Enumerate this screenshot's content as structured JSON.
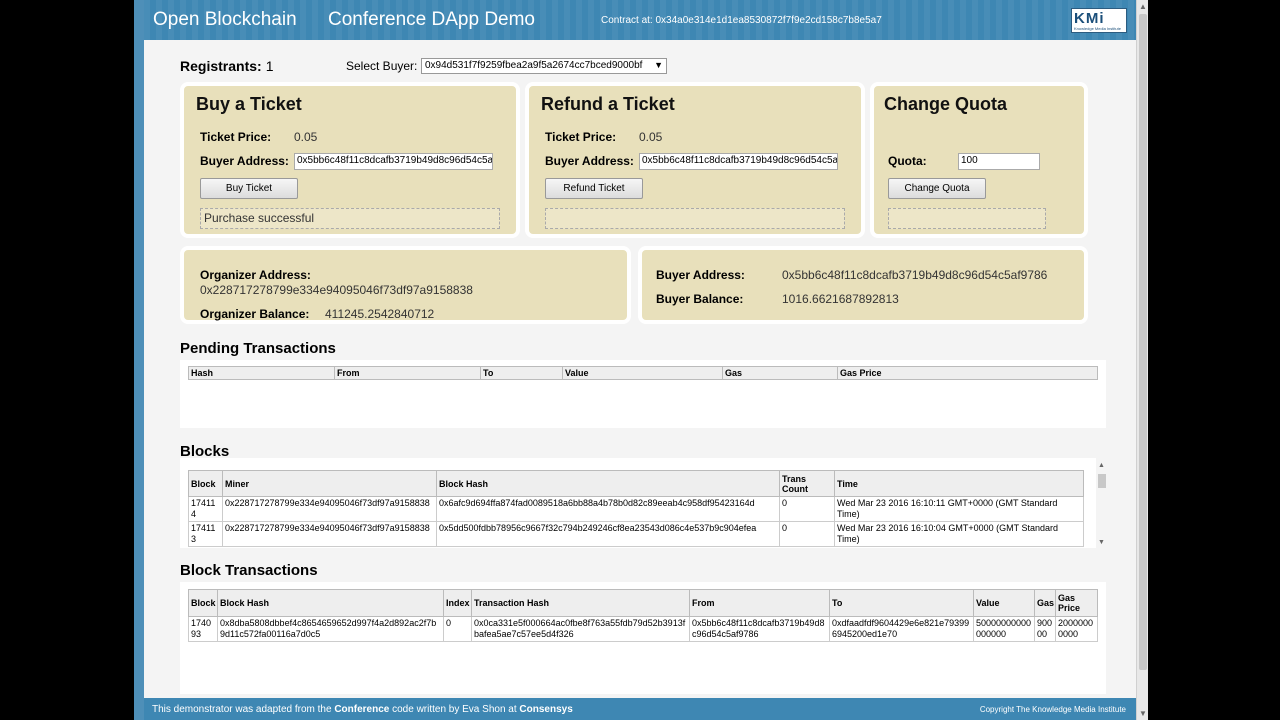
{
  "header": {
    "brand": "Open Blockchain",
    "title": "Conference DApp Demo",
    "contract": "Contract at: 0x34a0e314e1d1ea8530872f7f9e2cd158c7b8e5a7",
    "logo_letters": "KMi",
    "logo_small": "Knowledge Media Institute"
  },
  "registrants": {
    "label": "Registrants:",
    "value": "1"
  },
  "select_buyer": {
    "label": "Select Buyer:",
    "value": "0x94d531f7f9259fbea2a9f5a2674cc7bced9000bf"
  },
  "buy": {
    "title": "Buy a Ticket",
    "price_label": "Ticket Price:",
    "price_value": "0.05",
    "buyer_label": "Buyer Address:",
    "buyer_value": "0x5bb6c48f11c8dcafb3719b49d8c96d54c5a",
    "button": "Buy Ticket",
    "message": "Purchase successful"
  },
  "refund": {
    "title": "Refund a Ticket",
    "price_label": "Ticket Price:",
    "price_value": "0.05",
    "buyer_label": "Buyer Address:",
    "buyer_value": "0x5bb6c48f11c8dcafb3719b49d8c96d54c5a",
    "button": "Refund Ticket",
    "message": ""
  },
  "quota": {
    "title": "Change Quota",
    "quota_label": "Quota:",
    "quota_value": "100",
    "button": "Change Quota",
    "message": ""
  },
  "organizer": {
    "address_label": "Organizer Address:",
    "address_value": "0x228717278799e334e94095046f73df97a9158838",
    "balance_label": "Organizer Balance:",
    "balance_value": "411245.2542840712"
  },
  "buyer_info": {
    "address_label": "Buyer Address:",
    "address_value": "0x5bb6c48f11c8dcafb3719b49d8c96d54c5af9786",
    "balance_label": "Buyer Balance:",
    "balance_value": "1016.6621687892813"
  },
  "pending": {
    "title": "Pending Transactions",
    "columns": [
      "Hash",
      "From",
      "To",
      "Value",
      "Gas",
      "Gas Price"
    ]
  },
  "blocks": {
    "title": "Blocks",
    "columns": [
      "Block",
      "Miner",
      "Block Hash",
      "Trans Count",
      "Time"
    ],
    "rows": [
      [
        "174114",
        "0x228717278799e334e94095046f73df97a9158838",
        "0x6afc9d694ffa874fad0089518a6bb88a4b78b0d82c89eeab4c958df95423164d",
        "0",
        "Wed Mar 23 2016 16:10:11 GMT+0000 (GMT Standard Time)"
      ],
      [
        "174113",
        "0x228717278799e334e94095046f73df97a9158838",
        "0x5dd500fdbb78956c9667f32c794b249246cf8ea23543d086c4e537b9c904efea",
        "0",
        "Wed Mar 23 2016 16:10:04 GMT+0000 (GMT Standard Time)"
      ]
    ]
  },
  "block_tx": {
    "title": "Block Transactions",
    "columns": [
      "Block",
      "Block Hash",
      "Index",
      "Transaction Hash",
      "From",
      "To",
      "Value",
      "Gas",
      "Gas Price"
    ],
    "rows": [
      [
        "174093",
        "0x8dba5808dbbef4c8654659652d997f4a2d892ac2f7b9d11c572fa00116a7d0c5",
        "0",
        "0x0ca331e5f000664ac0fbe8f763a55fdb79d52b3913fbafea5ae7c57ee5d4f326",
        "0x5bb6c48f11c8dcafb3719b49d8c96d54c5af9786",
        "0xdfaadfdf9604429e6e821e793996945200ed1e70",
        "50000000000000000",
        "90000",
        "20000000000"
      ]
    ]
  },
  "footer": {
    "prefix": "This demonstrator was adapted from the ",
    "conference": "Conference",
    "middle": " code written by Eva Shon at ",
    "consensys": "Consensys",
    "copyright": "Copyright The Knowledge Media Institute"
  }
}
